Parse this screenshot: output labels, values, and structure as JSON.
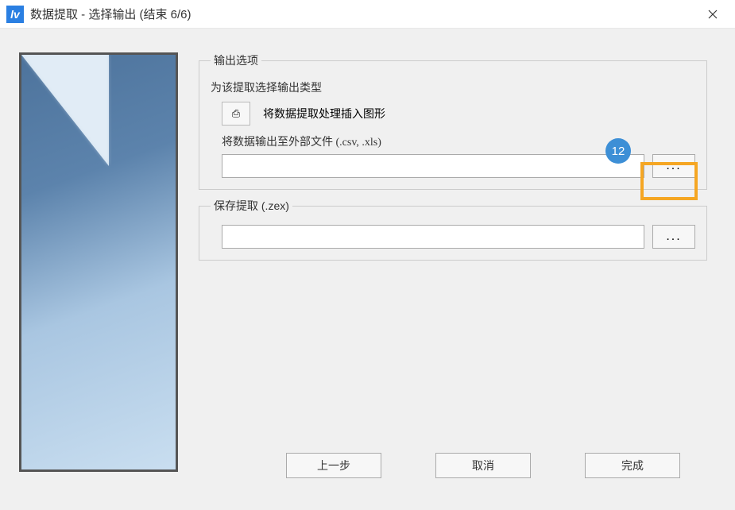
{
  "window": {
    "title": "数据提取 - 选择输出 (结束 6/6)",
    "icon_name": "app-icon"
  },
  "groups": {
    "output_options": {
      "legend": "输出选项",
      "subtitle": "为该提取选择输出类型",
      "insert_action_label": "将数据提取处理插入图形",
      "export_file_label": "将数据输出至外部文件 (.csv, .xls)",
      "export_file_value": "",
      "browse_label": "..."
    },
    "save_extraction": {
      "legend": "保存提取 (.zex)",
      "save_path_value": "",
      "browse_label": "..."
    }
  },
  "badge": {
    "number": "12"
  },
  "buttons": {
    "back": "上一步",
    "cancel": "取消",
    "finish": "完成"
  },
  "icons": {
    "insert_glyph": "⎙"
  }
}
